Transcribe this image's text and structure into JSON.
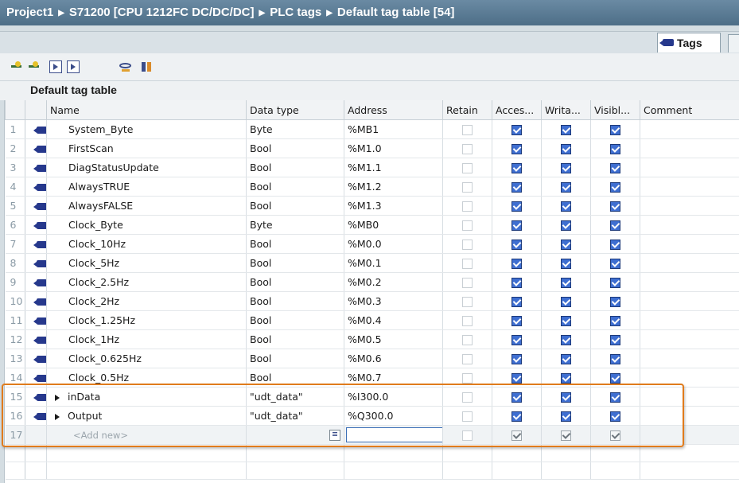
{
  "breadcrumb": {
    "items": [
      "Project1",
      "S71200 [CPU 1212FC DC/DC/DC]",
      "PLC tags",
      "Default tag table [54]"
    ],
    "separator": "▶"
  },
  "tabs": {
    "active_label": "Tags"
  },
  "toolbar": {
    "icons": [
      "add-row-icon",
      "insert-row-icon",
      "export-icon",
      "import-icon",
      "monitor-icon",
      "columns-icon"
    ]
  },
  "section": {
    "title": "Default tag table"
  },
  "table": {
    "headers": {
      "name": "Name",
      "datatype": "Data type",
      "address": "Address",
      "retain": "Retain",
      "accessible": "Acces...",
      "writable": "Writa...",
      "visible": "Visibl...",
      "comment": "Comment"
    },
    "rows": [
      {
        "num": "1",
        "name": "System_Byte",
        "datatype": "Byte",
        "address": "%MB1"
      },
      {
        "num": "2",
        "name": "FirstScan",
        "datatype": "Bool",
        "address": "%M1.0"
      },
      {
        "num": "3",
        "name": "DiagStatusUpdate",
        "datatype": "Bool",
        "address": "%M1.1"
      },
      {
        "num": "4",
        "name": "AlwaysTRUE",
        "datatype": "Bool",
        "address": "%M1.2"
      },
      {
        "num": "5",
        "name": "AlwaysFALSE",
        "datatype": "Bool",
        "address": "%M1.3"
      },
      {
        "num": "6",
        "name": "Clock_Byte",
        "datatype": "Byte",
        "address": "%MB0"
      },
      {
        "num": "7",
        "name": "Clock_10Hz",
        "datatype": "Bool",
        "address": "%M0.0"
      },
      {
        "num": "8",
        "name": "Clock_5Hz",
        "datatype": "Bool",
        "address": "%M0.1"
      },
      {
        "num": "9",
        "name": "Clock_2.5Hz",
        "datatype": "Bool",
        "address": "%M0.2"
      },
      {
        "num": "10",
        "name": "Clock_2Hz",
        "datatype": "Bool",
        "address": "%M0.3"
      },
      {
        "num": "11",
        "name": "Clock_1.25Hz",
        "datatype": "Bool",
        "address": "%M0.4"
      },
      {
        "num": "12",
        "name": "Clock_1Hz",
        "datatype": "Bool",
        "address": "%M0.5"
      },
      {
        "num": "13",
        "name": "Clock_0.625Hz",
        "datatype": "Bool",
        "address": "%M0.6"
      },
      {
        "num": "14",
        "name": "Clock_0.5Hz",
        "datatype": "Bool",
        "address": "%M0.7"
      },
      {
        "num": "15",
        "name": "inData",
        "datatype": "\"udt_data\"",
        "address": "%I300.0"
      },
      {
        "num": "16",
        "name": "Output",
        "datatype": "\"udt_data\"",
        "address": "%Q300.0"
      }
    ],
    "add_row": {
      "num": "17",
      "placeholder": "<Add new>",
      "address": ""
    }
  }
}
